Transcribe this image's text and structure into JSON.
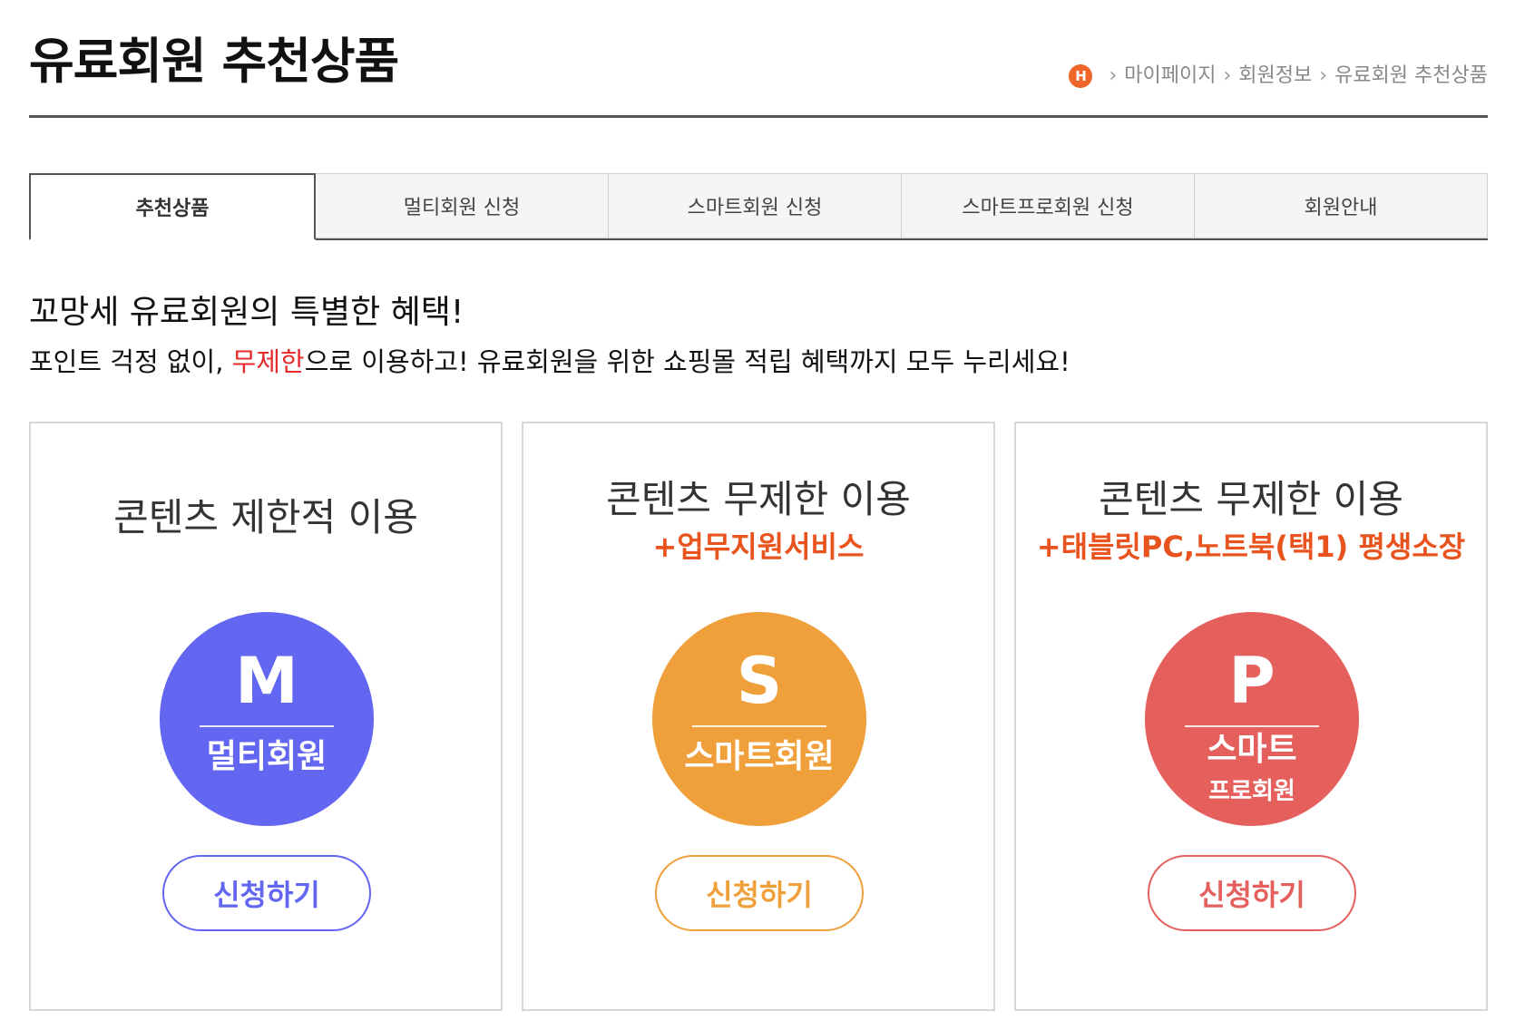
{
  "header": {
    "title": "유료회원 추천상품",
    "breadcrumb": {
      "home_icon": "H",
      "items": [
        "마이페이지",
        "회원정보",
        "유료회원 추천상품"
      ]
    }
  },
  "tabs": [
    {
      "label": "추천상품",
      "active": true
    },
    {
      "label": "멀티회원 신청",
      "active": false
    },
    {
      "label": "스마트회원 신청",
      "active": false
    },
    {
      "label": "스마트프로회원 신청",
      "active": false
    },
    {
      "label": "회원안내",
      "active": false
    }
  ],
  "intro": {
    "headline": "꼬망세 유료회원의 특별한 혜택!",
    "sub_before": "포인트 걱정 없이, ",
    "sub_highlight": "무제한",
    "sub_after": "으로 이용하고! 유료회원을 위한 쇼핑몰 적립 혜택까지 모두 누리세요!"
  },
  "cards": [
    {
      "title": "콘텐츠 제한적 이용",
      "subtitle": "",
      "letter": "M",
      "name": "멀티회원",
      "name2": "",
      "button": "신청하기",
      "color": "#6366f1"
    },
    {
      "title": "콘텐츠 무제한 이용",
      "subtitle": "+업무지원서비스",
      "letter": "S",
      "name": "스마트회원",
      "name2": "",
      "button": "신청하기",
      "color": "#f0a03a"
    },
    {
      "title": "콘텐츠 무제한 이용",
      "subtitle": "+태블릿PC,노트북(택1) 평생소장",
      "letter": "P",
      "name": "스마트",
      "name2": "프로회원",
      "button": "신청하기",
      "color": "#e5605d"
    }
  ],
  "colors": {
    "subtitle_accent": "#e9541e",
    "highlight_red": "#e52b2b"
  }
}
